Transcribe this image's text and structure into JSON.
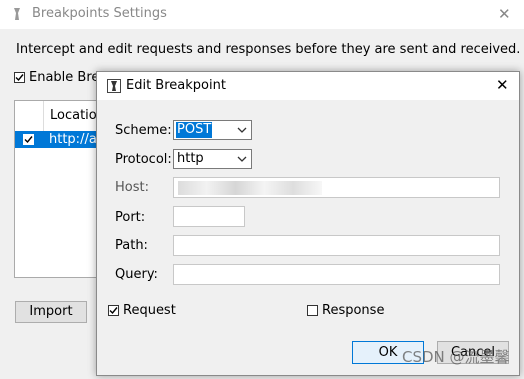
{
  "background_window": {
    "title": "Breakpoints Settings",
    "description": "Intercept and edit requests and responses before they are sent and received.",
    "enable_label": "Enable Bre",
    "enable_checked": true,
    "table": {
      "column_header": "Location",
      "rows": [
        {
          "url": "http://ap",
          "checked": true,
          "selected": true
        }
      ]
    },
    "import_button": "Import"
  },
  "dialog": {
    "title": "Edit Breakpoint",
    "scheme": {
      "label": "Scheme:",
      "value": "POST"
    },
    "protocol": {
      "label": "Protocol:",
      "value": "http"
    },
    "host": {
      "label": "Host:",
      "value": ""
    },
    "port": {
      "label": "Port:",
      "value": ""
    },
    "path": {
      "label": "Path:",
      "value": ""
    },
    "query": {
      "label": "Query:",
      "value": ""
    },
    "request": {
      "label": "Request",
      "checked": true
    },
    "response": {
      "label": "Response",
      "checked": false
    },
    "ok_button": "OK",
    "cancel_button": "Cancel"
  },
  "watermark": "CSDN @流墨馨",
  "colors": {
    "selection": "#0078d7",
    "dialog_bg": "#f0f0f0"
  }
}
